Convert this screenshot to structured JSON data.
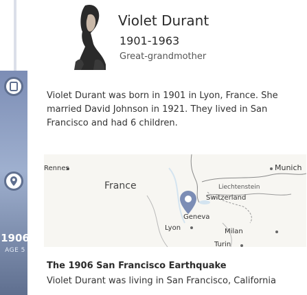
{
  "person": {
    "name": "Violet Durant",
    "years": "1901-1963",
    "relation": "Great-grandmother"
  },
  "bio": {
    "text": "Violet Durant was born in 1901 in Lyon, France. She married David Johnson in 1921. They lived in San Francisco and had 6 children."
  },
  "map": {
    "labels": {
      "rennes": "Rennes",
      "france": "France",
      "munich": "Munich",
      "liechtenstein": "Liechtenstein",
      "switzerland": "Switzerland",
      "geneva": "Geneva",
      "lyon": "Lyon",
      "milan": "Milan",
      "turin": "Turin"
    }
  },
  "timeline": {
    "year": "1906",
    "age_label": "AGE 5"
  },
  "event": {
    "title": "The 1906 San Francisco Earthquake",
    "text": "Violet Durant was living in San Francisco, California"
  },
  "colors": {
    "rail": "#7c8db5",
    "pin": "#7c8db5",
    "map_bg": "#f7f6f2"
  }
}
